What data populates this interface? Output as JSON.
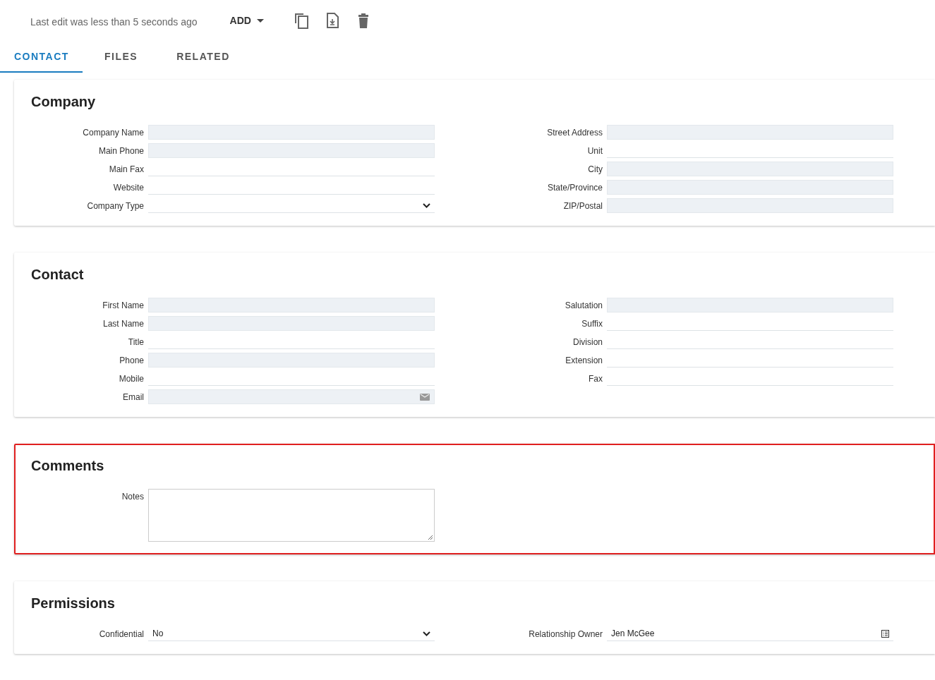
{
  "toolbar": {
    "status": "Last edit was less than 5 seconds ago",
    "add_button": "ADD"
  },
  "tabs": [
    {
      "label": "CONTACT",
      "selected": true
    },
    {
      "label": "FILES",
      "selected": false
    },
    {
      "label": "RELATED",
      "selected": false
    }
  ],
  "sections": [
    {
      "title": "Company",
      "highlighted": false,
      "left": [
        {
          "label": "Company Name",
          "kind": "shaded"
        },
        {
          "label": "Main Phone",
          "kind": "shaded"
        },
        {
          "label": "Main Fax",
          "kind": "line"
        },
        {
          "label": "Website",
          "kind": "line"
        },
        {
          "label": "Company Type",
          "kind": "select"
        }
      ],
      "right": [
        {
          "label": "Street Address",
          "kind": "shaded"
        },
        {
          "label": "Unit",
          "kind": "line"
        },
        {
          "label": "City",
          "kind": "shaded"
        },
        {
          "label": "State/Province",
          "kind": "shaded"
        },
        {
          "label": "ZIP/Postal",
          "kind": "shaded"
        }
      ]
    },
    {
      "title": "Contact",
      "highlighted": false,
      "left": [
        {
          "label": "First Name",
          "kind": "shaded"
        },
        {
          "label": "Last Name",
          "kind": "shaded"
        },
        {
          "label": "Title",
          "kind": "line"
        },
        {
          "label": "Phone",
          "kind": "shaded"
        },
        {
          "label": "Mobile",
          "kind": "line"
        },
        {
          "label": "Email",
          "kind": "email"
        }
      ],
      "right": [
        {
          "label": "Salutation",
          "kind": "shaded"
        },
        {
          "label": "Suffix",
          "kind": "line"
        },
        {
          "label": "Division",
          "kind": "line"
        },
        {
          "label": "Extension",
          "kind": "line"
        },
        {
          "label": "Fax",
          "kind": "line"
        }
      ]
    },
    {
      "title": "Comments",
      "highlighted": true,
      "left": [
        {
          "label": "Notes",
          "kind": "textarea"
        }
      ]
    },
    {
      "title": "Permissions",
      "highlighted": false,
      "left": [
        {
          "label": "Confidential",
          "kind": "select",
          "value": "No"
        }
      ],
      "right": [
        {
          "label": "Relationship Owner",
          "kind": "lookup",
          "value": "Jen McGee"
        }
      ]
    }
  ]
}
